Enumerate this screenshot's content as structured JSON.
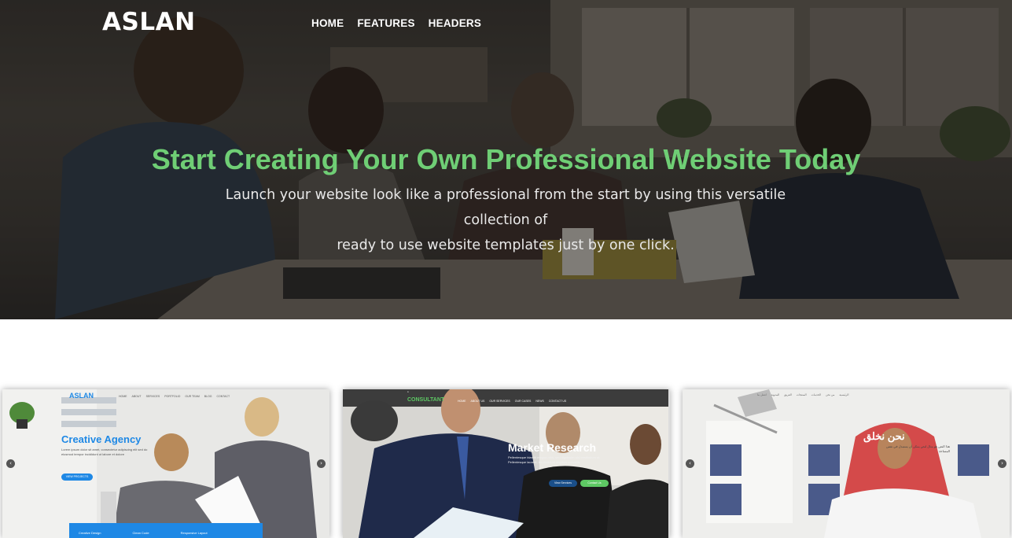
{
  "header": {
    "logo": "ASLAN",
    "nav": [
      "HOME",
      "FEATURES",
      "HEADERS"
    ]
  },
  "hero": {
    "title": "Start Creating Your Own Professional Website Today",
    "subtitle_line1": "Launch your website look like a professional from the start by using this versatile collection of",
    "subtitle_line2": "ready to use website templates just by one click."
  },
  "colors": {
    "accent_green": "#6fce75",
    "creative_blue": "#1e88e5",
    "consultant_green": "#5ec864"
  },
  "cards": [
    {
      "brand": "ASLAN",
      "nav": [
        "HOME",
        "ABOUT",
        "SERVICES",
        "PORTFOLIO",
        "OUR TEAM",
        "BLOG",
        "CONTACT"
      ],
      "heading": "Creative Agency",
      "text": "Lorem ipsum dolor sit amet, consectetur adipiscing elit sed do eiusmod tempor incididunt ut labore et dolore",
      "button": "VIEW PROJECTS",
      "features": [
        "Creative Design",
        "Clean Code",
        "Responsive Layout"
      ]
    },
    {
      "brand": "CONSULTANT",
      "nav": [
        "HOME",
        "ABOUT US",
        "OUR SERVICES",
        "OUR CASES",
        "NEWS",
        "CONTACT US"
      ],
      "heading": "Market Research",
      "text": "Pellentesque blandit magna nibh, sed dignissim nisl vestibulum ut. Pellentesque laoreet, leo tincidunt dapibus convallis",
      "buttons": [
        "View Services",
        "Contact Us"
      ]
    },
    {
      "nav": [
        "الرئيسية",
        "من نحن",
        "الخدمات",
        "المنتجات",
        "الفريق",
        "المدونة",
        "اتصل بنا"
      ],
      "heading": "نحن نخلق",
      "text": "هذا النص هو مثال لنص يمكن أن يستبدل في نفس المساحة"
    }
  ],
  "icons": [
    "chevron-left-icon",
    "chevron-right-icon"
  ]
}
